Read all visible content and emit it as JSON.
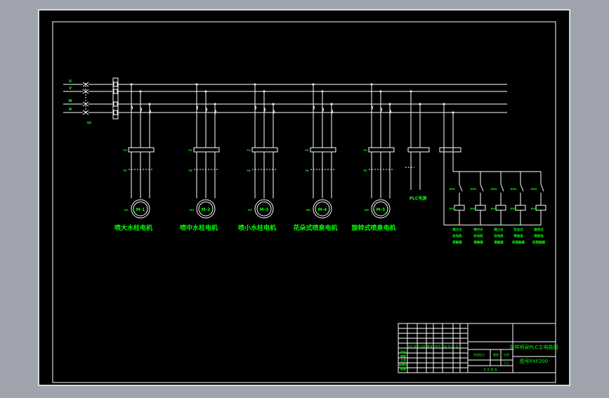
{
  "colors": {
    "background_outer": "#9ea3ae",
    "drawing_bg": "#000000",
    "line": "#ffffff",
    "label": "#00ff00"
  },
  "phases": [
    "U",
    "V",
    "W",
    "N"
  ],
  "motor_circuits": [
    {
      "motor_id": "M-1",
      "title": "喷大水柱电机"
    },
    {
      "motor_id": "M-2",
      "title": "喷中水柱电机"
    },
    {
      "motor_id": "M-3",
      "title": "喷小水柱电机"
    },
    {
      "motor_id": "M-4",
      "title": "花朵式喷泉电机"
    },
    {
      "motor_id": "M-5",
      "title": "旋转式喷泉电机"
    }
  ],
  "component_labels": {
    "fuse": "FU",
    "thermal_relay": "FR",
    "switch": "QS"
  },
  "plc_supply_label": "PLC电源",
  "control_relays": [
    {
      "id": "KM1",
      "desc": [
        "喷大水",
        "柱电机",
        "接触器"
      ]
    },
    {
      "id": "KM2",
      "desc": [
        "喷中水",
        "柱电机",
        "接触器"
      ]
    },
    {
      "id": "KM3",
      "desc": [
        "喷小水",
        "柱电机",
        "接触器"
      ]
    },
    {
      "id": "KM4",
      "desc": [
        "花朵式",
        "喷泉电",
        "机接触器"
      ]
    },
    {
      "id": "KM5",
      "desc": [
        "旋转式",
        "喷泉电",
        "机接触器"
      ]
    }
  ],
  "title_block": {
    "drawing_title": "花样喷泉PLC主电路图",
    "drawing_number": "图号PXF200",
    "scale": "1:1",
    "revision_header": "标记 处数 分区 更改文件号 签名 年 月 日",
    "stage_header": "阶段标记",
    "weight_header": "重量",
    "scale_header": "比例",
    "row_labels": [
      "设计",
      "审核",
      "工艺",
      "标准化",
      "批准"
    ],
    "sheet": "共 张 第 张"
  }
}
